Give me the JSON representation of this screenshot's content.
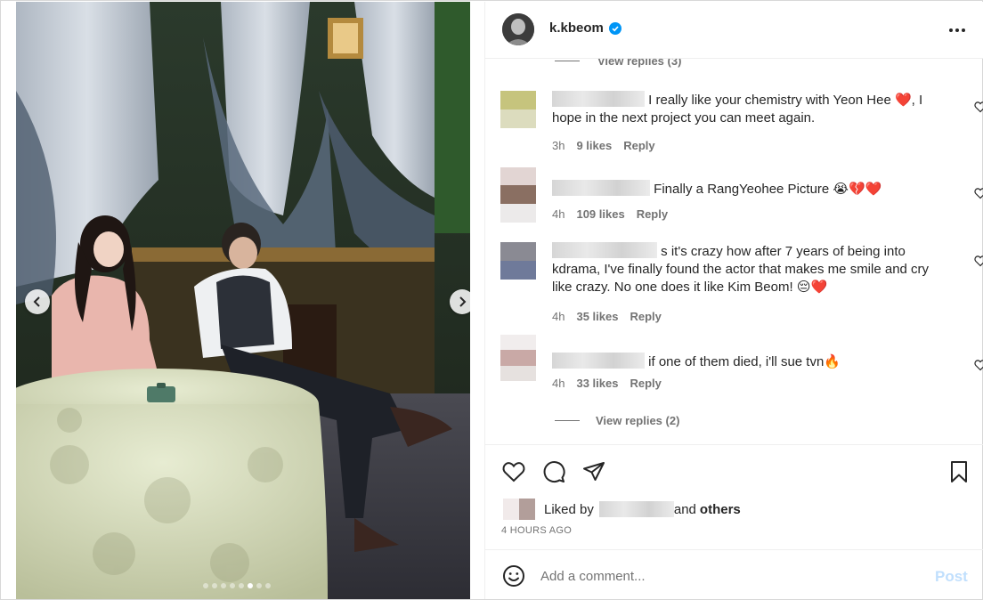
{
  "post": {
    "username": "k.kbeom",
    "more_label": "•••",
    "carousel": {
      "total_slides": 8,
      "active_slide": 6
    }
  },
  "comments": {
    "view_replies_top": "View replies (3)",
    "items": [
      {
        "text": "I really like your chemistry with Yeon Hee ❤️, I hope in the next project you can meet again.",
        "time": "3h",
        "likes": "9 likes",
        "reply": "Reply"
      },
      {
        "text": "Finally a RangYeohee Picture 😭💔❤️",
        "time": "4h",
        "likes": "109 likes",
        "reply": "Reply"
      },
      {
        "text": "s it's crazy how after 7 years of being into kdrama, I've finally found the actor that makes me smile and cry like crazy. No one does it like Kim Beom! 😔❤️",
        "time": "4h",
        "likes": "35 likes",
        "reply": "Reply"
      },
      {
        "text": "if one of them died, i'll sue tvn🔥",
        "time": "4h",
        "likes": "33 likes",
        "reply": "Reply"
      }
    ],
    "view_replies_bottom": "View replies (2)"
  },
  "likes_section": {
    "liked_by_prefix": "Liked by",
    "and_label": "and",
    "others_label": "others",
    "timestamp": "4 HOURS AGO"
  },
  "add_comment": {
    "placeholder": "Add a comment...",
    "post_label": "Post"
  },
  "colors": {
    "verified_blue": "#0095f6",
    "post_disabled": "#c0dffd",
    "meta_gray": "#737373"
  },
  "icons": [
    "verified-badge-icon",
    "more-icon",
    "heart-icon",
    "comment-icon",
    "share-icon",
    "bookmark-icon",
    "emoji-icon",
    "chevron-left-icon",
    "chevron-right-icon"
  ]
}
